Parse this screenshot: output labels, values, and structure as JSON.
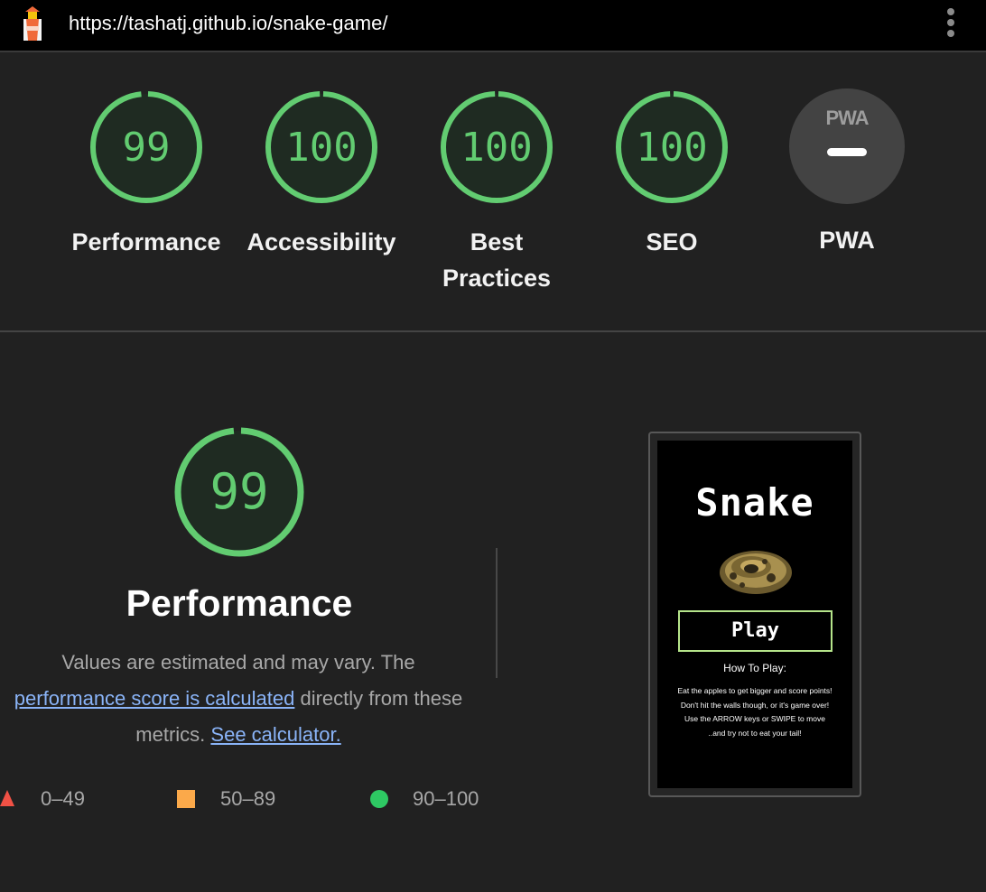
{
  "topbar": {
    "url": "https://tashatj.github.io/snake-game/",
    "app_icon": "lighthouse-icon",
    "menu_icon": "kebab-menu-icon"
  },
  "gauges": [
    {
      "label": "Performance",
      "score": "99",
      "value": 99
    },
    {
      "label": "Accessibility",
      "score": "100",
      "value": 100
    },
    {
      "label": "Best Practices",
      "score": "100",
      "value": 100
    },
    {
      "label": "SEO",
      "score": "100",
      "value": 100
    },
    {
      "label": "PWA",
      "score": "",
      "logo": "PWA"
    }
  ],
  "performance": {
    "score": "99",
    "value": 99,
    "title": "Performance",
    "desc_prefix": "Values are estimated and may vary. The ",
    "desc_link": "performance score is calculated",
    "desc_middle": " directly from these metrics. ",
    "calc_link": "See calculator."
  },
  "legend": [
    {
      "range": "0–49",
      "shape": "triangle",
      "color": "#f15145"
    },
    {
      "range": "50–89",
      "shape": "square",
      "color": "#fba94a"
    },
    {
      "range": "90–100",
      "shape": "circle",
      "color": "#2ec963"
    }
  ],
  "screenshot": {
    "title": "Snake",
    "play": "Play",
    "how_to": "How To Play:",
    "lines": [
      "Eat the apples to get bigger and score points!",
      "Don't hit the walls though, or it's game over!",
      "Use the ARROW keys or SWIPE to move",
      "..and try not to eat your tail!"
    ]
  },
  "colors": {
    "pass": "#62cc71",
    "pass_bg": "#1f2b22",
    "link": "#8ab4f8",
    "background": "#212121"
  }
}
